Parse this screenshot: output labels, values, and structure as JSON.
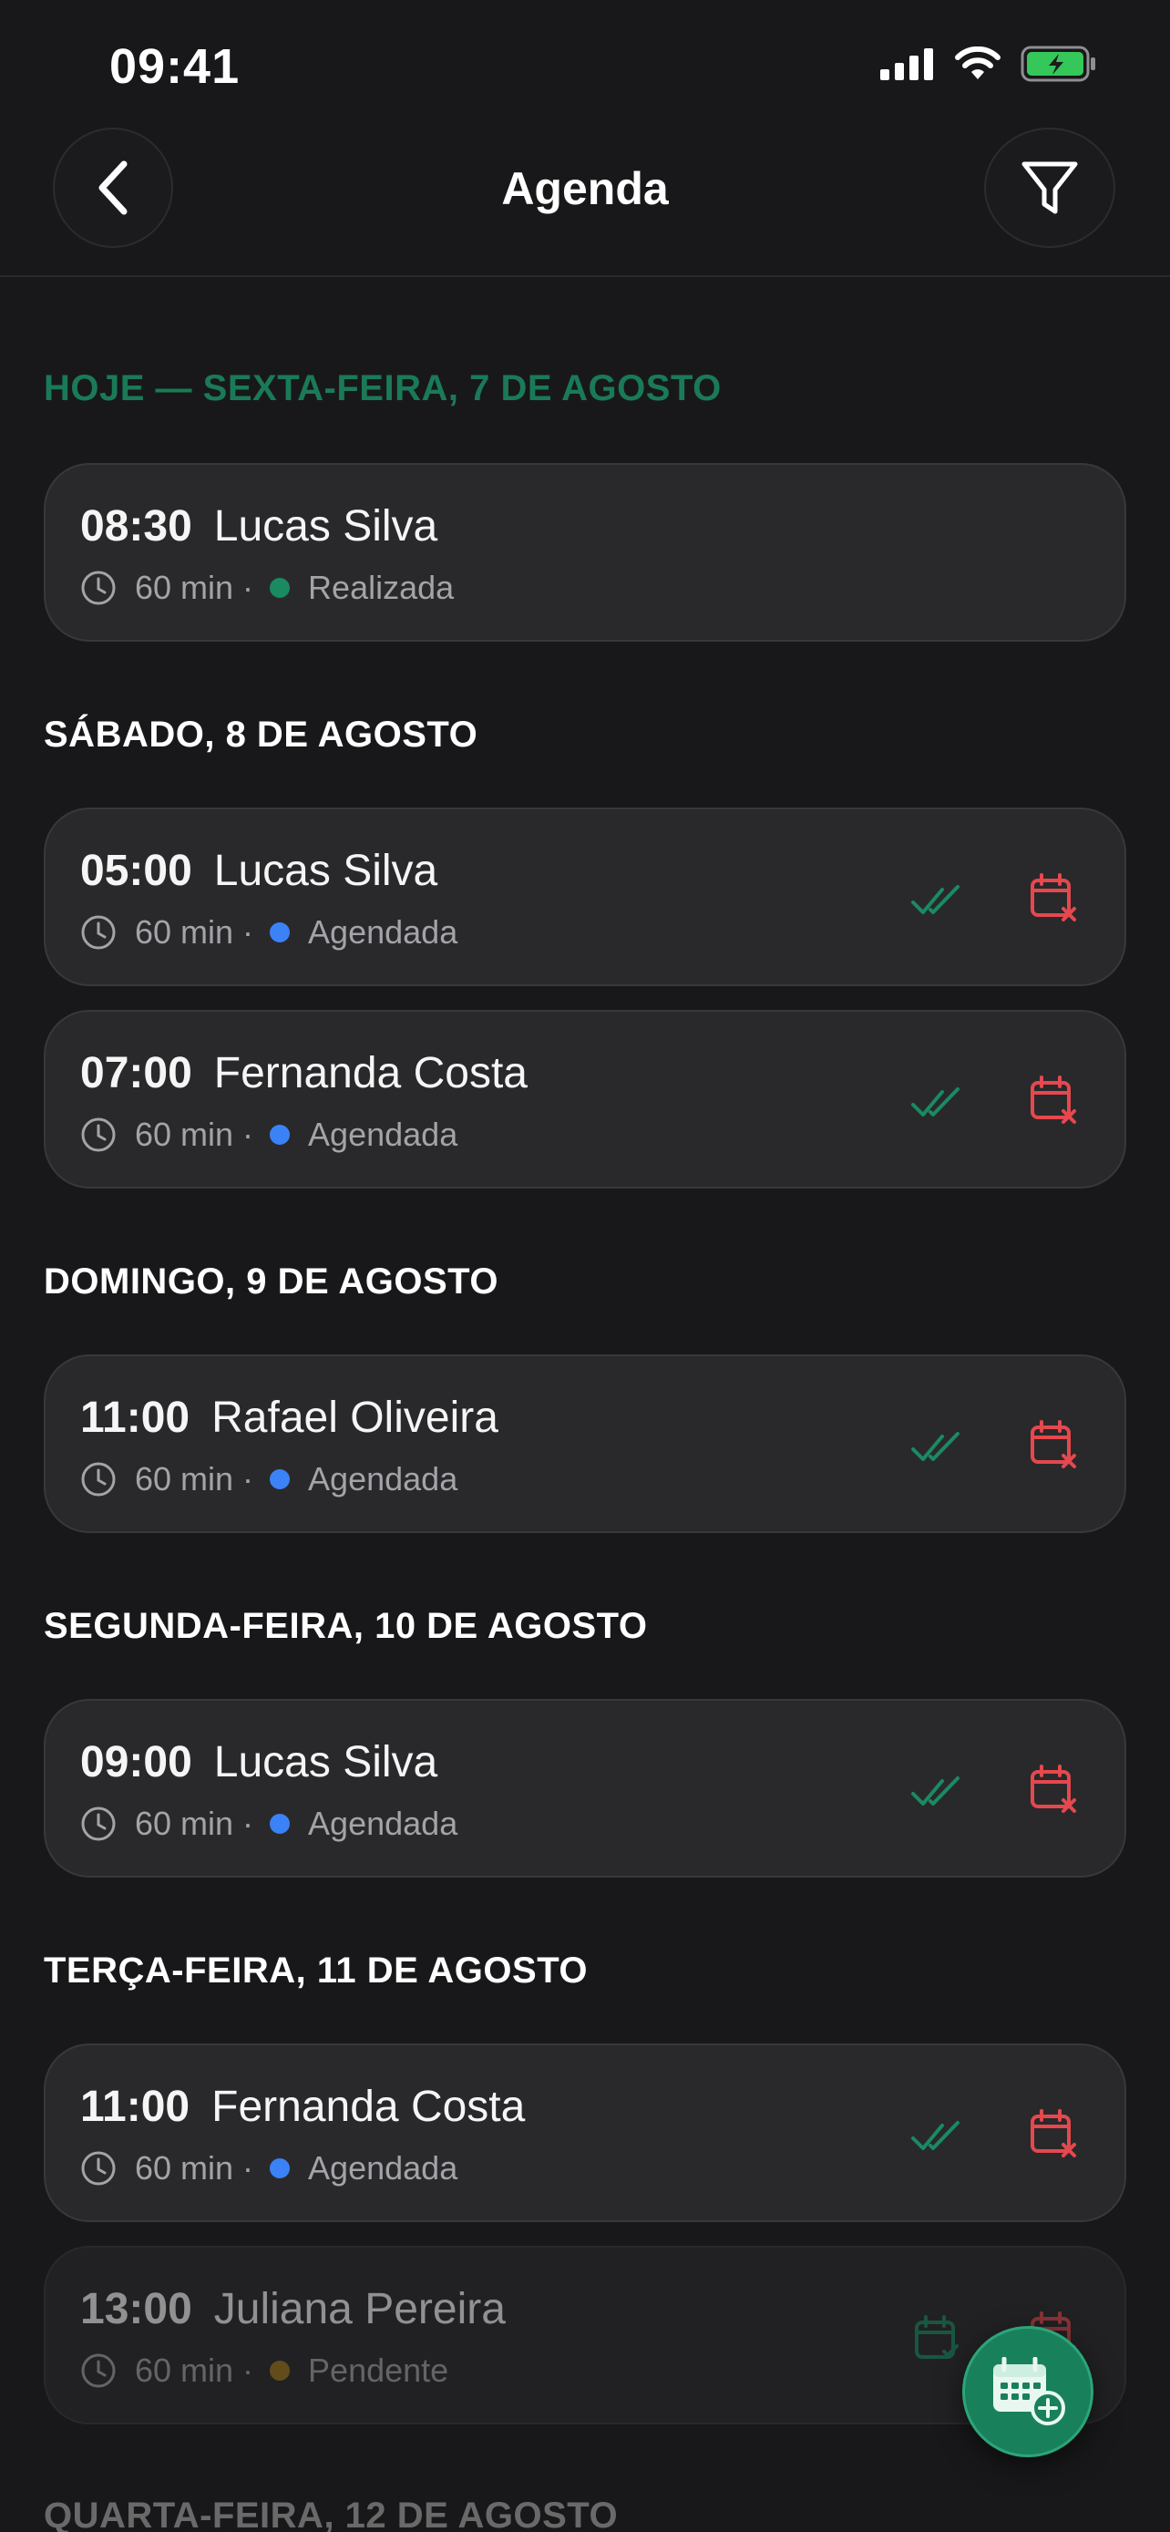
{
  "status_bar": {
    "time": "09:41"
  },
  "header": {
    "title": "Agenda"
  },
  "sections": [
    {
      "title": "HOJE — SEXTA-FEIRA, 7 DE AGOSTO"
    },
    {
      "title": "SÁBADO, 8 DE AGOSTO"
    },
    {
      "title": "DOMINGO, 9 DE AGOSTO"
    },
    {
      "title": "SEGUNDA-FEIRA, 10 DE AGOSTO"
    },
    {
      "title": "TERÇA-FEIRA, 11 DE AGOSTO"
    },
    {
      "title": "QUARTA-FEIRA, 12 DE AGOSTO"
    }
  ],
  "appointments": [
    {
      "time": "08:30",
      "name": "Lucas Silva",
      "duration": "60 min ·",
      "status": "Realizada",
      "status_color": "#1a8a62",
      "actions": false
    },
    {
      "time": "05:00",
      "name": "Lucas Silva",
      "duration": "60 min ·",
      "status": "Agendada",
      "status_color": "#3b82f6",
      "actions": true
    },
    {
      "time": "07:00",
      "name": "Fernanda Costa",
      "duration": "60 min ·",
      "status": "Agendada",
      "status_color": "#3b82f6",
      "actions": true
    },
    {
      "time": "11:00",
      "name": "Rafael Oliveira",
      "duration": "60 min ·",
      "status": "Agendada",
      "status_color": "#3b82f6",
      "actions": true
    },
    {
      "time": "09:00",
      "name": "Lucas Silva",
      "duration": "60 min ·",
      "status": "Agendada",
      "status_color": "#3b82f6",
      "actions": true
    },
    {
      "time": "11:00",
      "name": "Fernanda Costa",
      "duration": "60 min ·",
      "status": "Agendada",
      "status_color": "#3b82f6",
      "actions": true
    },
    {
      "time": "13:00",
      "name": "Juliana Pereira",
      "duration": "60 min ·",
      "status": "Pendente",
      "status_color": "#a07a1a",
      "actions": true
    }
  ],
  "icons": {
    "back": "chevron-left-icon",
    "filter": "filter-icon",
    "clock": "clock-icon",
    "confirm": "double-check-icon",
    "cancel": "calendar-x-icon",
    "fab": "calendar-add-icon"
  },
  "colors": {
    "accent": "#19805c",
    "today": "#1a7a57",
    "cancel": "#e5484d",
    "scheduled": "#3b82f6"
  }
}
